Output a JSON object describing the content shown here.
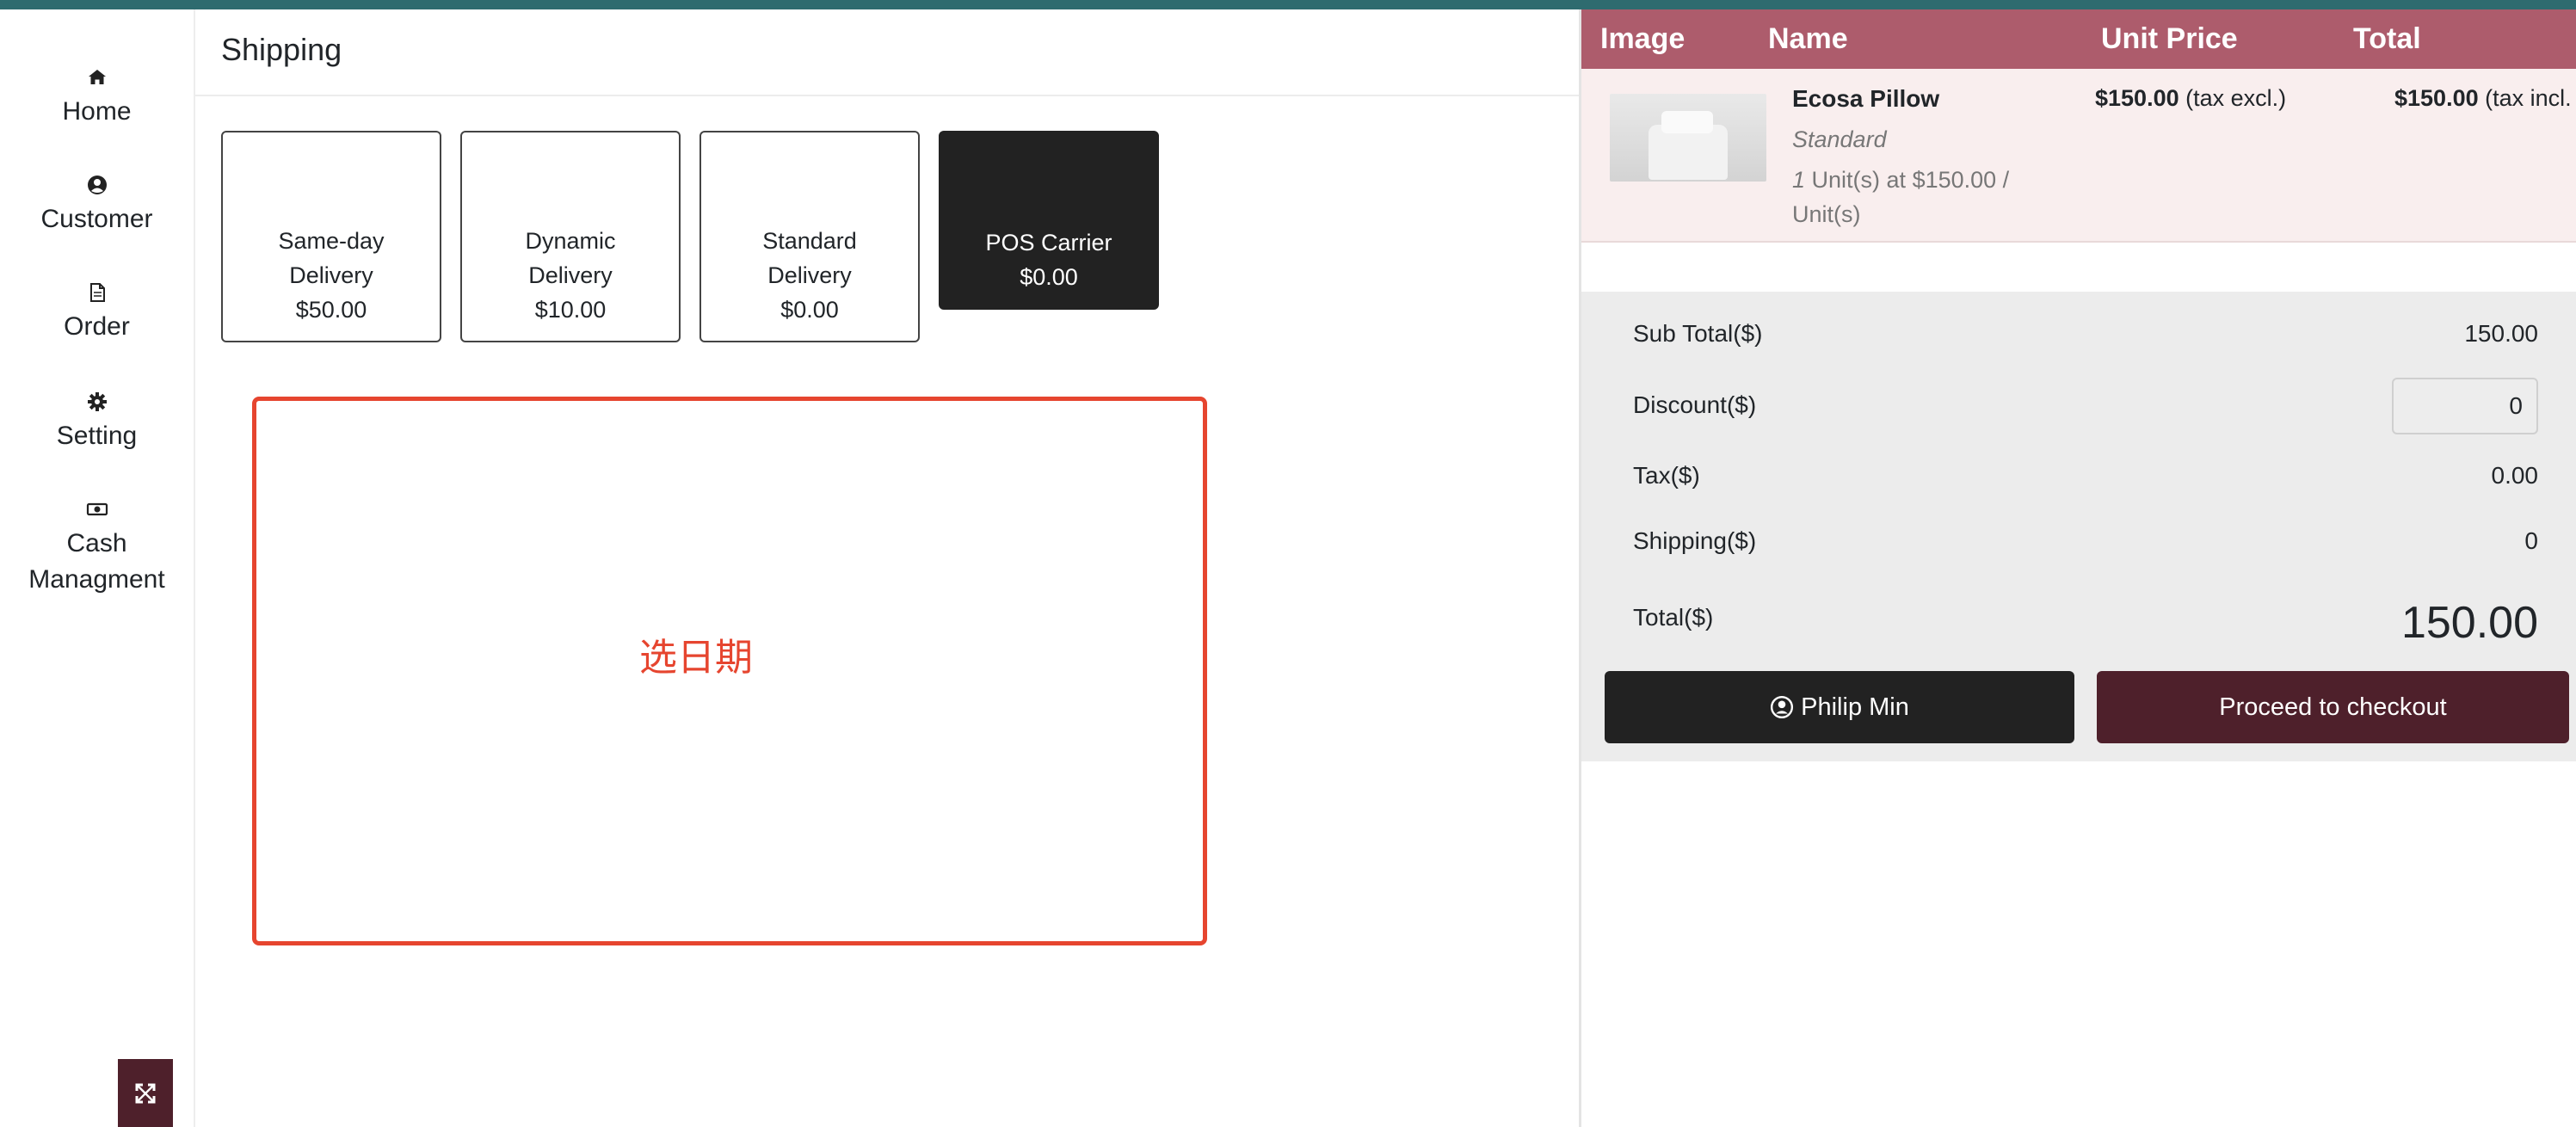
{
  "sidebar": {
    "items": [
      {
        "label": "Home",
        "icon": "home-icon"
      },
      {
        "label": "Customer",
        "icon": "user-circle-icon"
      },
      {
        "label": "Order",
        "icon": "document-icon"
      },
      {
        "label": "Setting",
        "icon": "gear-icon"
      },
      {
        "label": "Cash\nManagment",
        "label_line1": "Cash",
        "label_line2": "Managment",
        "icon": "money-icon"
      }
    ],
    "expand_icon": "expand-icon"
  },
  "main": {
    "title": "Shipping",
    "shipping_options": [
      {
        "name": "Same-day Delivery",
        "price": "$50.00",
        "selected": false
      },
      {
        "name": "Dynamic Delivery",
        "price": "$10.00",
        "selected": false
      },
      {
        "name": "Standard Delivery",
        "price": "$0.00",
        "selected": false
      },
      {
        "name": "POS Carrier",
        "price": "$0.00",
        "selected": true
      }
    ],
    "date_placeholder": "选日期"
  },
  "cart": {
    "headers": {
      "image": "Image",
      "name": "Name",
      "unit_price": "Unit Price",
      "total": "Total"
    },
    "items": [
      {
        "name": "Ecosa Pillow",
        "variant": "Standard",
        "qty_number": "1",
        "qty_text": "Unit(s) at $150.00 / Unit(s)",
        "unit_price_amount": "$150.00",
        "unit_price_note": "(tax excl.)",
        "total_amount": "$150.00",
        "total_note": "(tax incl."
      }
    ],
    "summary": {
      "subtotal_label": "Sub Total($)",
      "subtotal_value": "150.00",
      "discount_label": "Discount($)",
      "discount_value": "0",
      "tax_label": "Tax($)",
      "tax_value": "0.00",
      "shipping_label": "Shipping($)",
      "shipping_value": "0",
      "total_label": "Total($)",
      "total_value": "150.00"
    },
    "customer_button": "Philip Min",
    "checkout_button": "Proceed to checkout"
  },
  "colors": {
    "topbar": "#2e6b6f",
    "cart_header": "#ad5c6c",
    "accent_dark": "#4e202b",
    "selected_card": "#222222",
    "date_highlight": "#e6452f"
  }
}
